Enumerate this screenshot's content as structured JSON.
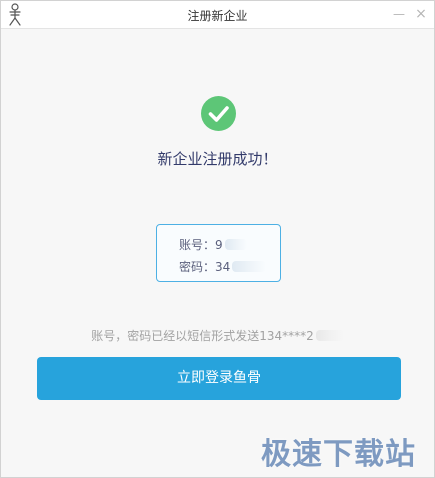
{
  "window": {
    "title": "注册新企业",
    "minimize_glyph": "—",
    "close_glyph": "×"
  },
  "success": {
    "icon": "check-circle-icon",
    "message": "新企业注册成功！",
    "color": "#5dc677"
  },
  "credentials": {
    "account_label": "账号：",
    "account_value": "9",
    "password_label": "密码：",
    "password_value": "34"
  },
  "sms_note": {
    "text": "账号，密码已经以短信形式发送134****2"
  },
  "login_button": {
    "label": "立即登录鱼骨",
    "color": "#27a3dc"
  },
  "watermark": {
    "text": "极速下载站"
  }
}
